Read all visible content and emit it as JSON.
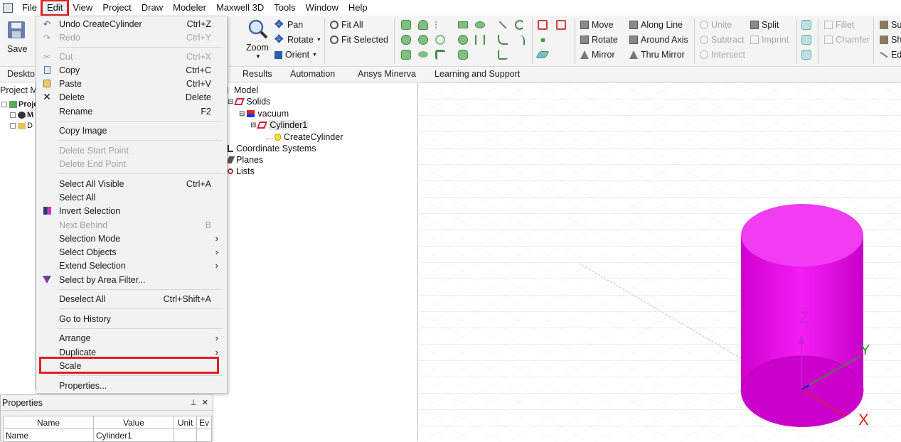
{
  "menubar": {
    "items": [
      "File",
      "Edit",
      "View",
      "Project",
      "Draw",
      "Modeler",
      "Maxwell 3D",
      "Tools",
      "Window",
      "Help"
    ],
    "active": "Edit"
  },
  "ribbon": {
    "save": "Save",
    "zoom": "Zoom",
    "pan": "Pan",
    "rotate": "Rotate",
    "orient": "Orient",
    "fit_all": "Fit All",
    "fit_selected": "Fit Selected",
    "move": "Move",
    "rotate2": "Rotate",
    "mirror": "Mirror",
    "along_line": "Along Line",
    "around_axis": "Around Axis",
    "thru_mirror": "Thru Mirror",
    "unite": "Unite",
    "subtract": "Subtract",
    "intersect": "Intersect",
    "split": "Split",
    "imprint": "Imprint",
    "fillet": "Fillet",
    "chamfer": "Chamfer",
    "su": "Su",
    "sh": "Sh",
    "ed": "Ed"
  },
  "tabs": {
    "desktop": "Deskto",
    "results": "Results",
    "automation": "Automation",
    "minerva": "Ansys Minerva",
    "learning": "Learning and Support"
  },
  "left_panel": {
    "title": "Project M",
    "item1": "Proje",
    "item2": "M",
    "item3": "D"
  },
  "tree": {
    "model": "Model",
    "solids": "Solids",
    "vacuum": "vacuum",
    "cylinder": "Cylinder1",
    "create": "CreateCylinder",
    "coord": "Coordinate Systems",
    "planes": "Planes",
    "lists": "Lists"
  },
  "edit_menu": {
    "undo": {
      "label": "Undo CreateCylinder",
      "shortcut": "Ctrl+Z"
    },
    "redo": {
      "label": "Redo",
      "shortcut": "Ctrl+Y"
    },
    "cut": {
      "label": "Cut",
      "shortcut": "Ctrl+X"
    },
    "copy": {
      "label": "Copy",
      "shortcut": "Ctrl+C"
    },
    "paste": {
      "label": "Paste",
      "shortcut": "Ctrl+V"
    },
    "delete": {
      "label": "Delete",
      "shortcut": "Delete"
    },
    "rename": {
      "label": "Rename",
      "shortcut": "F2"
    },
    "copy_image": {
      "label": "Copy Image"
    },
    "delete_start": {
      "label": "Delete Start Point"
    },
    "delete_end": {
      "label": "Delete End Point"
    },
    "select_all_visible": {
      "label": "Select All Visible",
      "shortcut": "Ctrl+A"
    },
    "select_all": {
      "label": "Select All"
    },
    "invert": {
      "label": "Invert Selection"
    },
    "next_behind": {
      "label": "Next Behind",
      "shortcut": "B"
    },
    "selection_mode": {
      "label": "Selection Mode"
    },
    "select_objects": {
      "label": "Select Objects"
    },
    "extend_selection": {
      "label": "Extend Selection"
    },
    "area_filter": {
      "label": "Select by Area Filter..."
    },
    "deselect_all": {
      "label": "Deselect All",
      "shortcut": "Ctrl+Shift+A"
    },
    "history": {
      "label": "Go to History"
    },
    "arrange": {
      "label": "Arrange"
    },
    "duplicate": {
      "label": "Duplicate"
    },
    "scale": {
      "label": "Scale"
    },
    "properties": {
      "label": "Properties..."
    },
    "submenu_arrow": "›"
  },
  "properties": {
    "title": "Properties",
    "pin": "⊥",
    "close": "✕",
    "columns": [
      "Name",
      "Value",
      "Unit",
      "Ev"
    ],
    "row": {
      "name": "Name",
      "value": "Cylinder1"
    }
  },
  "axes": {
    "x": "X",
    "y": "Y",
    "z": "Z"
  },
  "colors": {
    "cylinder": "#ee00ee",
    "highlight": "#e02020",
    "axis_z": "#cc22dd",
    "axis_x": "#e02020",
    "axis_y": "#20a020"
  }
}
